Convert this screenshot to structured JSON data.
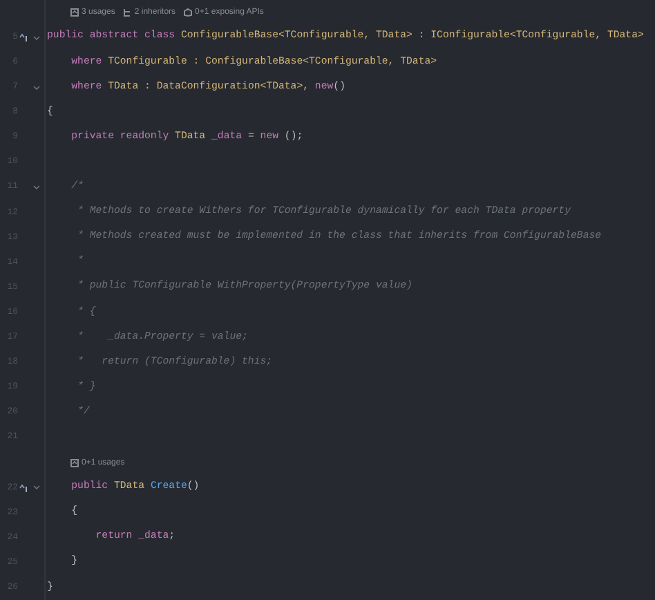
{
  "editor": {
    "rows": [
      {
        "kind": "hint",
        "hints": [
          {
            "kind": "usages",
            "text": "3 usages"
          },
          {
            "kind": "inheritors",
            "text": "2 inheritors"
          },
          {
            "kind": "apis",
            "text": "0+1 exposing APIs"
          }
        ]
      },
      {
        "kind": "code",
        "number": "5",
        "implemented": true,
        "fold": true,
        "tokens": [
          {
            "kind": "kw",
            "text": "public abstract class "
          },
          {
            "kind": "type",
            "text": "ConfigurableBase<TConfigurable, TData> : IConfigurable<TConfigurable, TData>"
          }
        ]
      },
      {
        "kind": "code",
        "number": "6",
        "implemented": false,
        "fold": false,
        "tokens": [
          {
            "kind": "kw",
            "text": "    where "
          },
          {
            "kind": "type",
            "text": "TConfigurable : ConfigurableBase<TConfigurable, TData>"
          }
        ]
      },
      {
        "kind": "code",
        "number": "7",
        "implemented": false,
        "fold": true,
        "tokens": [
          {
            "kind": "kw",
            "text": "    where "
          },
          {
            "kind": "type",
            "text": "TData : DataConfiguration<TData>, "
          },
          {
            "kind": "kw",
            "text": "new"
          },
          {
            "kind": "plain",
            "text": "()"
          }
        ]
      },
      {
        "kind": "code",
        "number": "8",
        "implemented": false,
        "fold": false,
        "tokens": [
          {
            "kind": "plain",
            "text": "{"
          }
        ]
      },
      {
        "kind": "code",
        "number": "9",
        "implemented": false,
        "fold": false,
        "tokens": [
          {
            "kind": "kw",
            "text": "    private readonly "
          },
          {
            "kind": "type",
            "text": "TData "
          },
          {
            "kind": "field",
            "text": "_data"
          },
          {
            "kind": "plain",
            "text": " = "
          },
          {
            "kind": "kw",
            "text": "new"
          },
          {
            "kind": "plain",
            "text": " ();"
          }
        ]
      },
      {
        "kind": "code",
        "number": "10",
        "implemented": false,
        "fold": false,
        "tokens": []
      },
      {
        "kind": "code",
        "number": "11",
        "implemented": false,
        "fold": true,
        "tokens": [
          {
            "kind": "comment",
            "text": "    /*"
          }
        ]
      },
      {
        "kind": "code",
        "number": "12",
        "implemented": false,
        "fold": false,
        "tokens": [
          {
            "kind": "comment",
            "text": "     * Methods to create Withers for TConfigurable dynamically for each TData property"
          }
        ]
      },
      {
        "kind": "code",
        "number": "13",
        "implemented": false,
        "fold": false,
        "tokens": [
          {
            "kind": "comment",
            "text": "     * Methods created must be implemented in the class that inherits from ConfigurableBase"
          }
        ]
      },
      {
        "kind": "code",
        "number": "14",
        "implemented": false,
        "fold": false,
        "tokens": [
          {
            "kind": "comment",
            "text": "     *"
          }
        ]
      },
      {
        "kind": "code",
        "number": "15",
        "implemented": false,
        "fold": false,
        "tokens": [
          {
            "kind": "comment",
            "text": "     * public TConfigurable WithProperty(PropertyType value)"
          }
        ]
      },
      {
        "kind": "code",
        "number": "16",
        "implemented": false,
        "fold": false,
        "tokens": [
          {
            "kind": "comment",
            "text": "     * {"
          }
        ]
      },
      {
        "kind": "code",
        "number": "17",
        "implemented": false,
        "fold": false,
        "tokens": [
          {
            "kind": "comment",
            "text": "     *    _data.Property = value;"
          }
        ]
      },
      {
        "kind": "code",
        "number": "18",
        "implemented": false,
        "fold": false,
        "tokens": [
          {
            "kind": "comment",
            "text": "     *   return (TConfigurable) this;"
          }
        ]
      },
      {
        "kind": "code",
        "number": "19",
        "implemented": false,
        "fold": false,
        "tokens": [
          {
            "kind": "comment",
            "text": "     * }"
          }
        ]
      },
      {
        "kind": "code",
        "number": "20",
        "implemented": false,
        "fold": false,
        "tokens": [
          {
            "kind": "comment",
            "text": "     */"
          }
        ]
      },
      {
        "kind": "code",
        "number": "21",
        "implemented": false,
        "fold": false,
        "tokens": []
      },
      {
        "kind": "hint",
        "hints": [
          {
            "kind": "usages",
            "text": "0+1 usages"
          }
        ]
      },
      {
        "kind": "code",
        "number": "22",
        "implemented": true,
        "fold": true,
        "tokens": [
          {
            "kind": "kw",
            "text": "    public "
          },
          {
            "kind": "type",
            "text": "TData "
          },
          {
            "kind": "method",
            "text": "Create"
          },
          {
            "kind": "plain",
            "text": "()"
          }
        ]
      },
      {
        "kind": "code",
        "number": "23",
        "implemented": false,
        "fold": false,
        "tokens": [
          {
            "kind": "plain",
            "text": "    {"
          }
        ]
      },
      {
        "kind": "code",
        "number": "24",
        "implemented": false,
        "fold": false,
        "tokens": [
          {
            "kind": "kw",
            "text": "        return "
          },
          {
            "kind": "field",
            "text": "_data"
          },
          {
            "kind": "plain",
            "text": ";"
          }
        ]
      },
      {
        "kind": "code",
        "number": "25",
        "implemented": false,
        "fold": false,
        "tokens": [
          {
            "kind": "plain",
            "text": "    }"
          }
        ]
      },
      {
        "kind": "code",
        "number": "26",
        "implemented": false,
        "fold": false,
        "tokens": [
          {
            "kind": "plain",
            "text": "}"
          }
        ]
      }
    ]
  }
}
